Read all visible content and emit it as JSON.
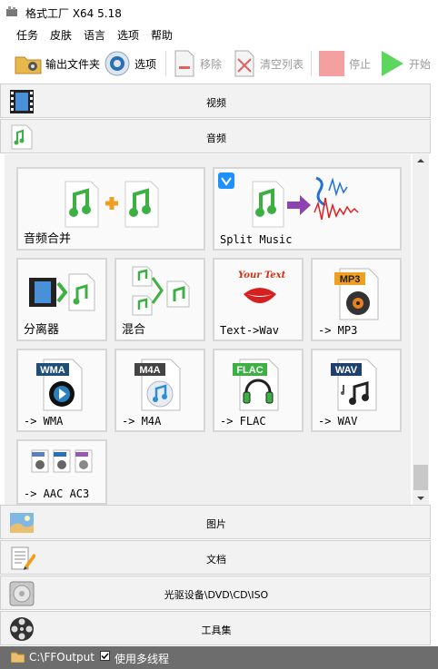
{
  "window": {
    "title": "格式工厂 X64 5.18"
  },
  "menu": [
    "任务",
    "皮肤",
    "语言",
    "选项",
    "帮助"
  ],
  "toolbar": {
    "output_folder": "输出文件夹",
    "options": "选项",
    "remove": "移除",
    "clear_list": "清空列表",
    "stop": "停止",
    "start": "开始"
  },
  "categories": {
    "video": "视频",
    "audio": "音频",
    "picture": "图片",
    "document": "文档",
    "disc": "光驱设备\\DVD\\CD\\ISO",
    "tools": "工具集"
  },
  "tiles": {
    "audio_join": "音频合并",
    "split_music": "Split Music",
    "demuxer": "分离器",
    "mix": "混合",
    "text_to_wav": "Text->Wav",
    "text_art": "Your Text",
    "to_mp3": "-> MP3",
    "to_wma": "-> WMA",
    "to_m4a": "-> M4A",
    "to_flac": "-> FLAC",
    "to_wav": "-> WAV",
    "to_aac_ac3": "-> AAC AC3"
  },
  "badges": {
    "mp3": "MP3",
    "wma": "WMA",
    "m4a": "M4A",
    "flac": "FLAC",
    "wav": "WAV"
  },
  "status": {
    "output_path": "C:\\FFOutput",
    "multithread_label": "使用多线程",
    "multithread_checked": true
  },
  "colors": {
    "music_green": "#3cb043",
    "status_bg": "#6d6d6d",
    "start_green": "#5cd65c",
    "stop_pink": "#f5a0a0"
  }
}
